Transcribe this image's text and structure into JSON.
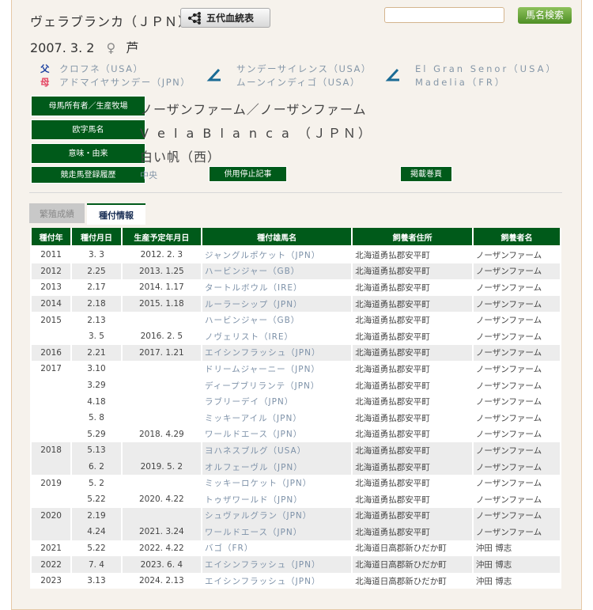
{
  "header": {
    "horse_name": "ヴェラブランカ（ＪＰＮ）",
    "pedigree_button": "五代血統表",
    "search_placeholder": "",
    "search_button": "馬名検索"
  },
  "profile": {
    "birth": "2007. 3. 2",
    "sex_symbol": "♀",
    "color": "芦"
  },
  "pedigree": {
    "sire_label": "父",
    "sire": "クロフネ（USA）",
    "dam_label": "母",
    "dam": "アドマイヤサンデー（JPN）",
    "dam_sire": "サンデーサイレンス（USA）",
    "dam_dam": "ムーンインディゴ（USA）",
    "dd_sire": "El Gran Senor（USA）",
    "dd_dam": "Madelia（FR）"
  },
  "info": [
    {
      "label": "母馬所有者／生産牧場",
      "value": "ノーザンファーム／ノーザンファーム"
    },
    {
      "label": "欧字馬名",
      "value": "V e l a  B l a n c a （ＪＰＮ）"
    },
    {
      "label": "意味・由来",
      "value": "白い帆（西）"
    },
    {
      "label": "競走馬登録履歴",
      "value": "中央"
    }
  ],
  "buttons": {
    "retire": "供用停止記事",
    "pages": "掲載巻頁"
  },
  "tabs": [
    {
      "label": "繁殖成績"
    },
    {
      "label": "種付情報"
    }
  ],
  "table": {
    "headers": [
      "種付年",
      "種付月日",
      "生産予定年月日",
      "種付雄馬名",
      "飼養者住所",
      "飼養者名"
    ],
    "rows": [
      [
        "2011",
        "3. 3",
        "2012. 2. 3",
        "ジャングルポケット（JPN）",
        "北海道勇払郡安平町",
        "ノーザンファーム"
      ],
      [
        "2012",
        "2.25",
        "2013. 1.25",
        "ハービンジャー（GB）",
        "北海道勇払郡安平町",
        "ノーザンファーム"
      ],
      [
        "2013",
        "2.17",
        "2014. 1.17",
        "タートルボウル（IRE）",
        "北海道勇払郡安平町",
        "ノーザンファーム"
      ],
      [
        "2014",
        "2.18",
        "2015. 1.18",
        "ルーラーシップ（JPN）",
        "北海道勇払郡安平町",
        "ノーザンファーム"
      ],
      [
        "2015",
        "2.13",
        "",
        "ハービンジャー（GB）",
        "北海道勇払郡安平町",
        "ノーザンファーム"
      ],
      [
        "",
        "3. 5",
        "2016. 2. 5",
        "ノヴェリスト（IRE）",
        "北海道勇払郡安平町",
        "ノーザンファーム"
      ],
      [
        "2016",
        "2.21",
        "2017. 1.21",
        "エイシンフラッシュ（JPN）",
        "北海道勇払郡安平町",
        "ノーザンファーム"
      ],
      [
        "2017",
        "3.10",
        "",
        "ドリームジャーニー（JPN）",
        "北海道勇払郡安平町",
        "ノーザンファーム"
      ],
      [
        "",
        "3.29",
        "",
        "ディープブリランテ（JPN）",
        "北海道勇払郡安平町",
        "ノーザンファーム"
      ],
      [
        "",
        "4.18",
        "",
        "ラブリーデイ（JPN）",
        "北海道勇払郡安平町",
        "ノーザンファーム"
      ],
      [
        "",
        "5. 8",
        "",
        "ミッキーアイル（JPN）",
        "北海道勇払郡安平町",
        "ノーザンファーム"
      ],
      [
        "",
        "5.29",
        "2018. 4.29",
        "ワールドエース（JPN）",
        "北海道勇払郡安平町",
        "ノーザンファーム"
      ],
      [
        "2018",
        "5.13",
        "",
        "ヨハネスブルグ（USA）",
        "北海道勇払郡安平町",
        "ノーザンファーム"
      ],
      [
        "",
        "6. 2",
        "2019. 5. 2",
        "オルフェーヴル（JPN）",
        "北海道勇払郡安平町",
        "ノーザンファーム"
      ],
      [
        "2019",
        "5. 2",
        "",
        "ミッキーロケット（JPN）",
        "北海道勇払郡安平町",
        "ノーザンファーム"
      ],
      [
        "",
        "5.22",
        "2020. 4.22",
        "トゥザワールド（JPN）",
        "北海道勇払郡安平町",
        "ノーザンファーム"
      ],
      [
        "2020",
        "2.19",
        "",
        "シュヴァルグラン（JPN）",
        "北海道勇払郡安平町",
        "ノーザンファーム"
      ],
      [
        "",
        "4.24",
        "2021. 3.24",
        "ワールドエース（JPN）",
        "北海道勇払郡安平町",
        "ノーザンファーム"
      ],
      [
        "2021",
        "5.22",
        "2022. 4.22",
        "バゴ（FR）",
        "北海道日高郡新ひだか町",
        "沖田 博志"
      ],
      [
        "2022",
        "7. 4",
        "2023. 6. 4",
        "エイシンフラッシュ（JPN）",
        "北海道日高郡新ひだか町",
        "沖田 博志"
      ],
      [
        "2023",
        "3.13",
        "2024. 2.13",
        "エイシンフラッシュ（JPN）",
        "北海道日高郡新ひだか町",
        "沖田 博志"
      ]
    ]
  }
}
